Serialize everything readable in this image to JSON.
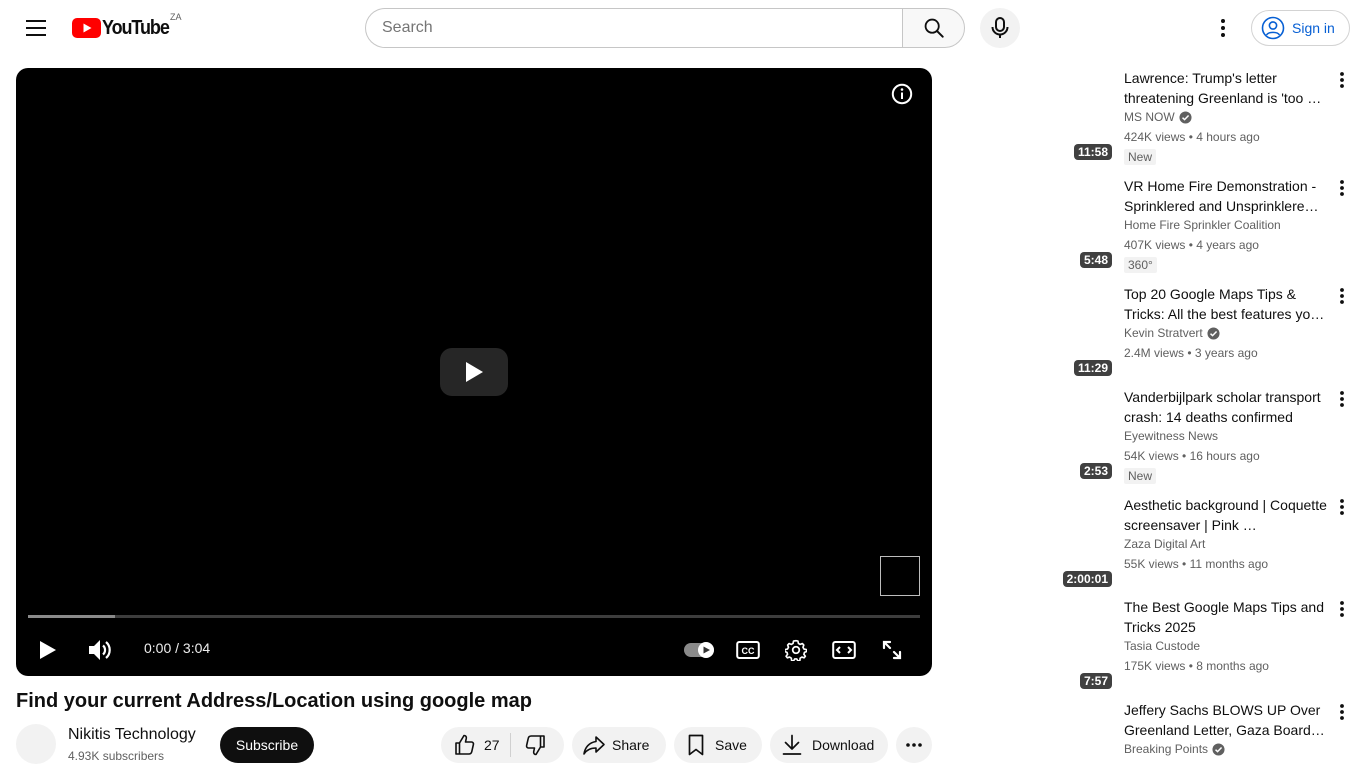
{
  "masthead": {
    "logo_text": "YouTube",
    "country_code": "ZA",
    "search_placeholder": "Search",
    "sign_in_label": "Sign in",
    "brand_color": "#ff0000",
    "link_color": "#065fd4"
  },
  "player": {
    "current_time": "0:00",
    "separator": " / ",
    "duration": "3:04",
    "progress_loaded_fraction": 0.098,
    "autoplay_on": true
  },
  "video": {
    "title": "Find your current Address/Location using google map",
    "channel_name": "Nikitis Technology",
    "subscribers": "4.93K subscribers",
    "subscribe_label": "Subscribe",
    "like_count": "27",
    "share_label": "Share",
    "save_label": "Save",
    "download_label": "Download"
  },
  "recommendations": [
    {
      "title": "Lawrence: Trump's letter threatening Greenland is 'too …",
      "channel": "MS NOW",
      "verified": true,
      "views": "424K views",
      "age": "4 hours ago",
      "badge": "New",
      "duration": "11:58"
    },
    {
      "title": "VR Home Fire Demonstration - Sprinklered and Unsprinklere…",
      "channel": "Home Fire Sprinkler Coalition",
      "verified": false,
      "views": "407K views",
      "age": "4 years ago",
      "badge": "360°",
      "duration": "5:48"
    },
    {
      "title": "Top 20 Google Maps Tips & Tricks: All the best features yo…",
      "channel": "Kevin Stratvert",
      "verified": true,
      "views": "2.4M views",
      "age": "3 years ago",
      "badge": "",
      "duration": "11:29"
    },
    {
      "title": "Vanderbijlpark scholar transport crash: 14 deaths confirmed",
      "channel": "Eyewitness News",
      "verified": false,
      "views": "54K views",
      "age": "16 hours ago",
      "badge": "New",
      "duration": "2:53"
    },
    {
      "title": "Aesthetic background | Coquette screensaver | Pink …",
      "channel": "Zaza Digital Art",
      "verified": false,
      "views": "55K views",
      "age": "11 months ago",
      "badge": "",
      "duration": "2:00:01"
    },
    {
      "title": "The Best Google Maps Tips and Tricks 2025",
      "channel": "Tasia Custode",
      "verified": false,
      "views": "175K views",
      "age": "8 months ago",
      "badge": "",
      "duration": "7:57"
    },
    {
      "title": "Jeffery Sachs BLOWS UP Over Greenland Letter, Gaza Board…",
      "channel": "Breaking Points",
      "verified": true,
      "views": "",
      "age": "",
      "badge": "",
      "duration": ""
    }
  ]
}
